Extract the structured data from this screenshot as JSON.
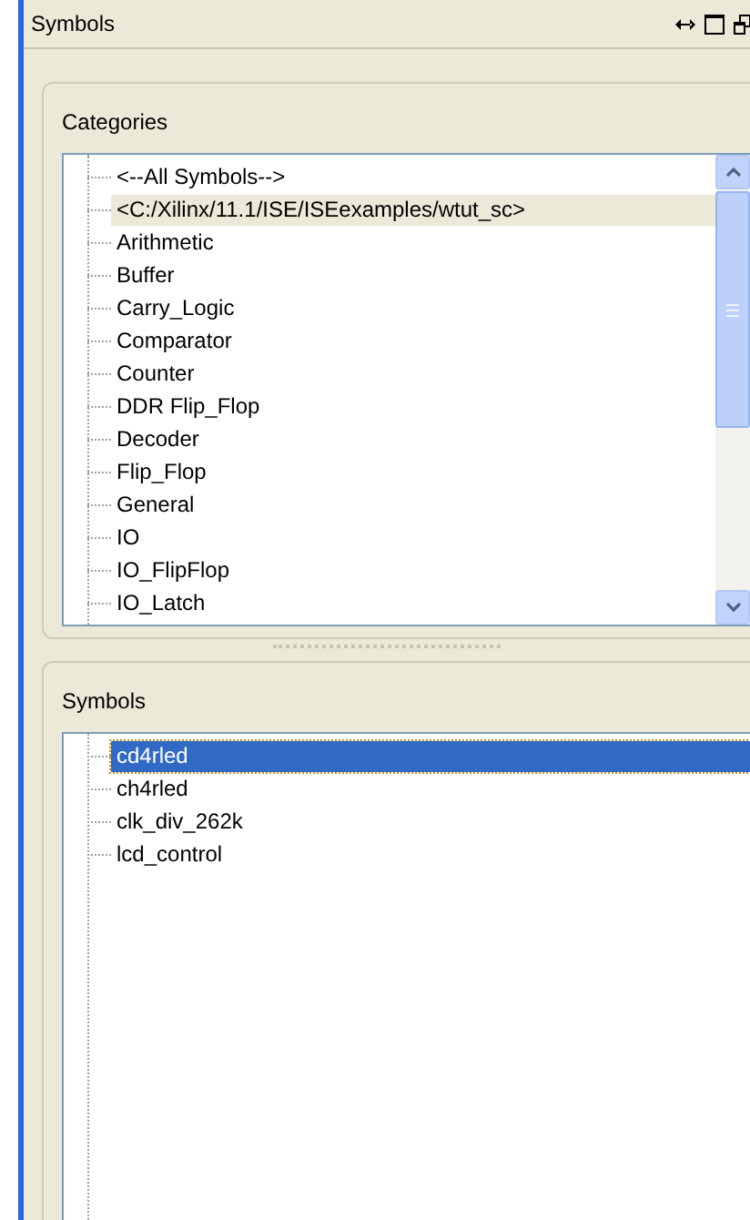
{
  "window": {
    "title": "Symbols"
  },
  "categories": {
    "label": "Categories",
    "items": [
      {
        "label": "<--All Symbols-->",
        "selected": false
      },
      {
        "label": "<C:/Xilinx/11.1/ISE/ISEexamples/wtut_sc>",
        "selected": true
      },
      {
        "label": "Arithmetic",
        "selected": false
      },
      {
        "label": "Buffer",
        "selected": false
      },
      {
        "label": "Carry_Logic",
        "selected": false
      },
      {
        "label": "Comparator",
        "selected": false
      },
      {
        "label": "Counter",
        "selected": false
      },
      {
        "label": "DDR Flip_Flop",
        "selected": false
      },
      {
        "label": "Decoder",
        "selected": false
      },
      {
        "label": "Flip_Flop",
        "selected": false
      },
      {
        "label": "General",
        "selected": false
      },
      {
        "label": "IO",
        "selected": false
      },
      {
        "label": "IO_FlipFlop",
        "selected": false
      },
      {
        "label": "IO_Latch",
        "selected": false
      }
    ]
  },
  "symbols": {
    "label": "Symbols",
    "items": [
      {
        "label": "cd4rled",
        "selected": true
      },
      {
        "label": "ch4rled",
        "selected": false
      },
      {
        "label": "clk_div_262k",
        "selected": false
      },
      {
        "label": "lcd_control",
        "selected": false
      }
    ]
  }
}
